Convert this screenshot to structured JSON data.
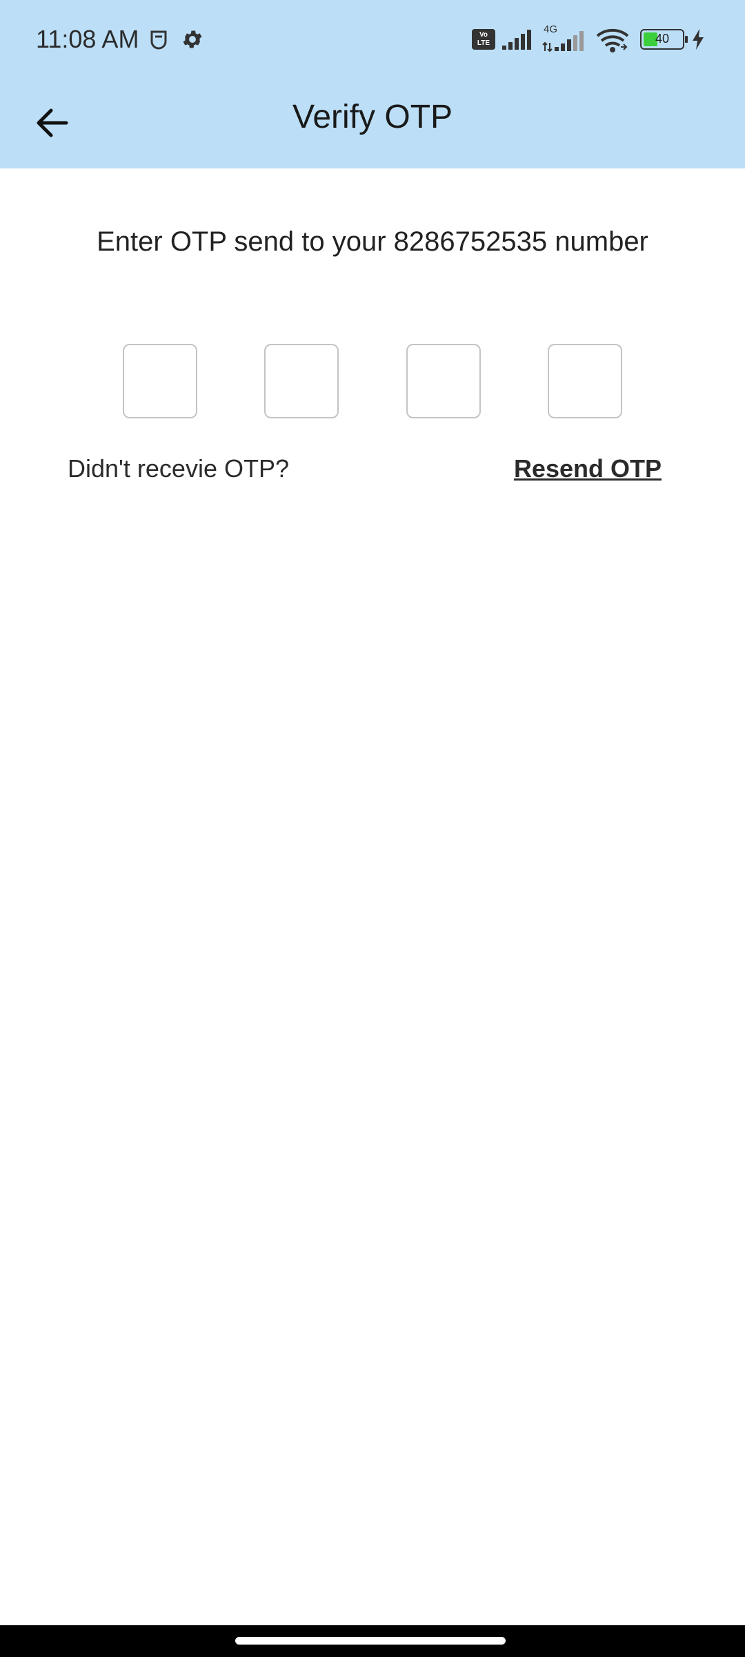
{
  "status_bar": {
    "time": "11:08 AM",
    "icons": [
      "pocket-icon",
      "gear-icon",
      "volte-icon",
      "signal-icon",
      "4g-signal-icon",
      "wifi-icon",
      "battery-icon",
      "charging-icon"
    ],
    "network_label": "4G",
    "volte_label_top": "Vo",
    "volte_label_bottom": "LTE",
    "battery_level": "40"
  },
  "app_bar": {
    "title": "Verify OTP",
    "back_icon": "arrow-left-icon"
  },
  "content": {
    "instruction": "Enter OTP send to your 8286752535 number",
    "otp_fields": [
      {
        "value": ""
      },
      {
        "value": ""
      },
      {
        "value": ""
      },
      {
        "value": ""
      }
    ],
    "not_received_text": "Didn't recevie OTP?",
    "resend_label": "Resend OTP"
  },
  "colors": {
    "header_bg": "#bcdff7",
    "battery_fill": "#3ccf3c",
    "nav_bar": "#000000"
  }
}
